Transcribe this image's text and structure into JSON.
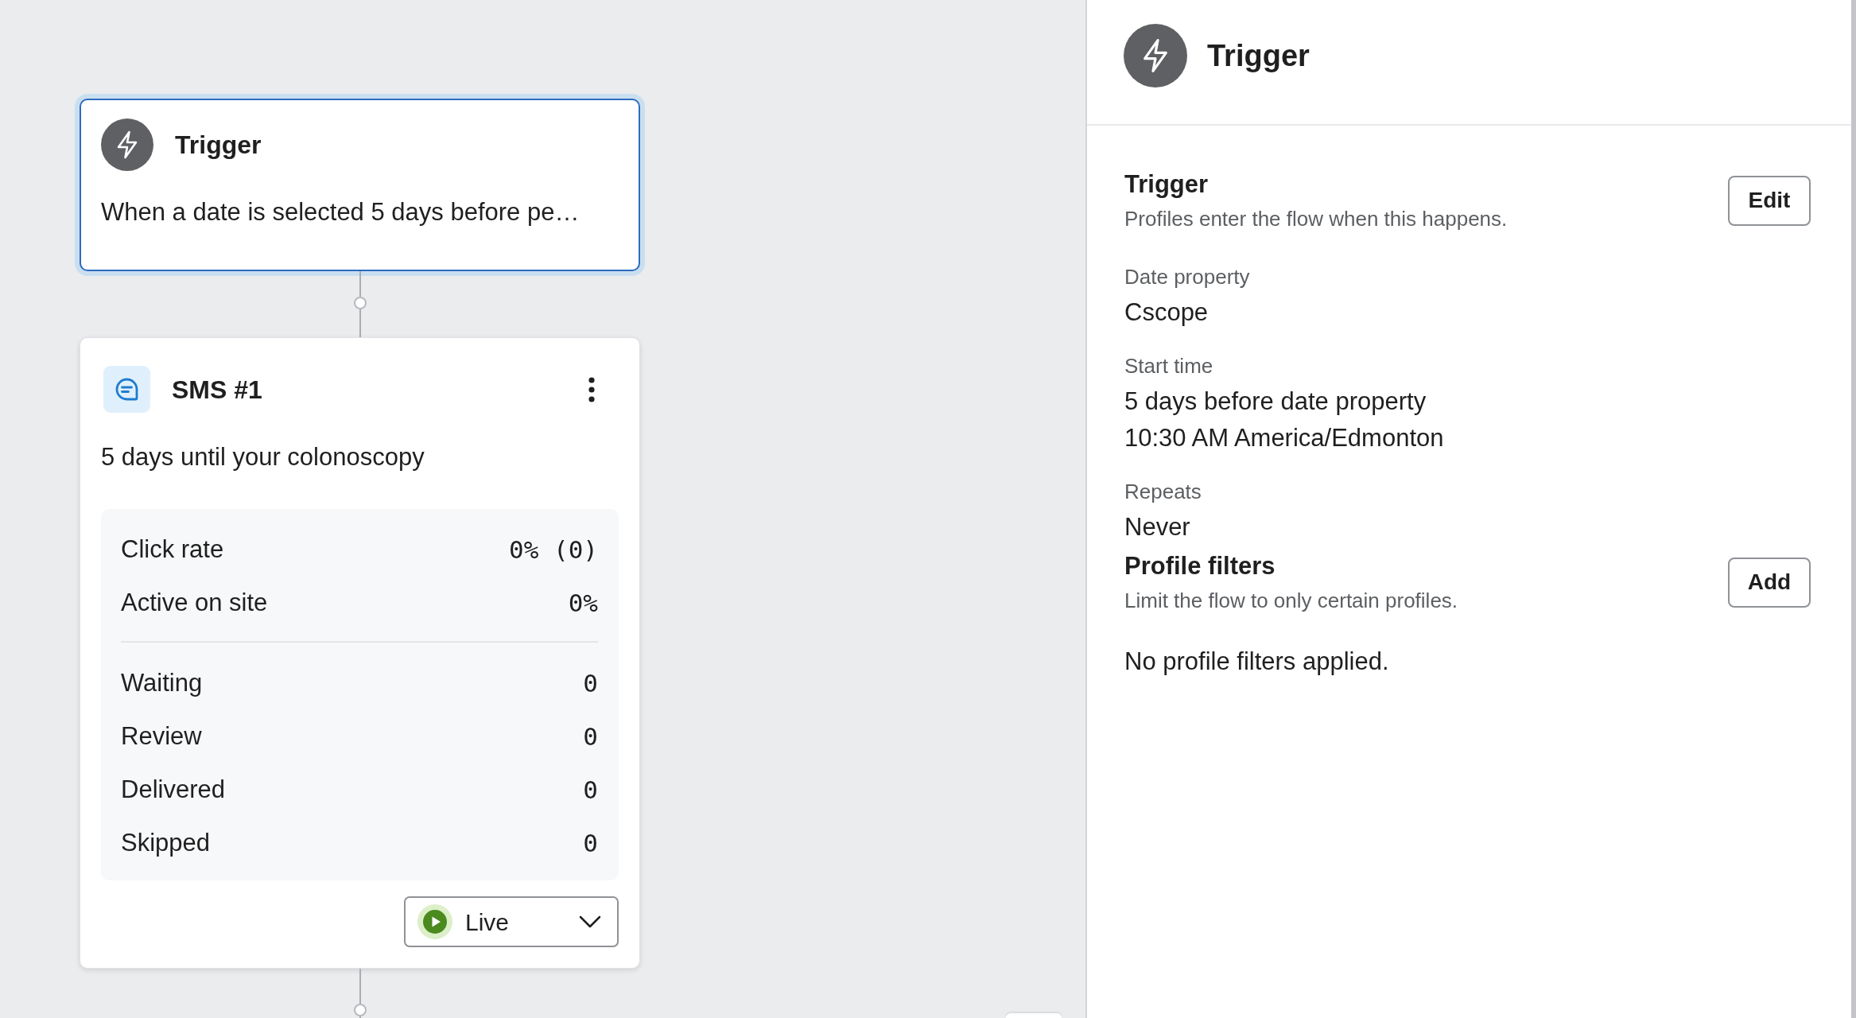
{
  "canvas": {
    "nodes": [
      {
        "kind": "trigger",
        "title": "Trigger",
        "description": "When a date is selected 5 days before pe…",
        "selected": true
      },
      {
        "kind": "sms",
        "title": "SMS #1",
        "description": "5 days until your colonoscopy",
        "selected": false,
        "stat_groups": [
          {
            "rows": [
              {
                "label": "Click rate",
                "value": "0% (0)"
              },
              {
                "label": "Active on site",
                "value": "0%"
              }
            ]
          },
          {
            "rows": [
              {
                "label": "Waiting",
                "value": "0"
              },
              {
                "label": "Review",
                "value": "0"
              },
              {
                "label": "Delivered",
                "value": "0"
              },
              {
                "label": "Skipped",
                "value": "0"
              }
            ]
          }
        ],
        "status": "Live"
      }
    ]
  },
  "panel": {
    "kind": "trigger",
    "title": "Trigger",
    "sections": [
      {
        "kind": "heading",
        "title": "Trigger",
        "subtitle": "Profiles enter the flow when this happens.",
        "button": "Edit"
      },
      {
        "kind": "field",
        "label": "Date property",
        "values": [
          "Cscope"
        ]
      },
      {
        "kind": "field",
        "label": "Start time",
        "values": [
          "5 days before date property",
          "10:30 AM America/Edmonton"
        ]
      },
      {
        "kind": "field",
        "label": "Repeats",
        "values": [
          "Never"
        ]
      },
      {
        "kind": "heading",
        "title": "Profile filters",
        "subtitle": "Limit the flow to only certain profiles.",
        "button": "Add"
      },
      {
        "kind": "note",
        "text": "No profile filters applied."
      }
    ]
  }
}
